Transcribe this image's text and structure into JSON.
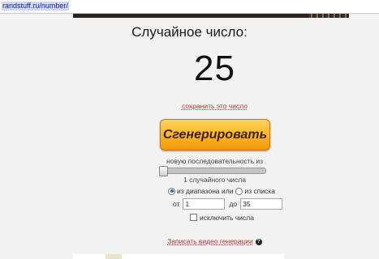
{
  "browser": {
    "url": "randstuff.ru/number/"
  },
  "page": {
    "title": "Случайное число:",
    "number": "25",
    "save_link": "сохранить это число",
    "generate_button": "Сгенерировать",
    "sequence_text": "новую последовательность из",
    "count_text": "1 случайного числа",
    "mode_range_label": "из диапазона или",
    "mode_list_label": "из списка",
    "from_label": "от",
    "from_value": "1",
    "to_label": "до",
    "to_value": "35",
    "exclude_label": "исключить числа",
    "video_link": "Записать видео генерации",
    "help_glyph": "?"
  },
  "colors": {
    "button_accent": "#ffb21f",
    "link": "#c0392b"
  }
}
